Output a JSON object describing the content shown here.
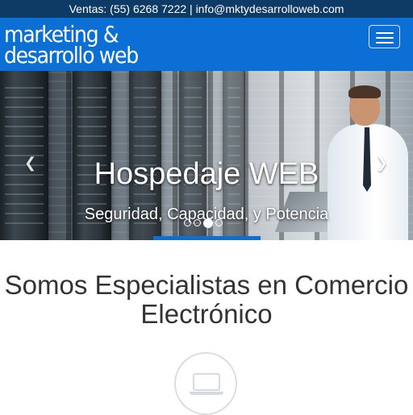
{
  "topbar": {
    "contact": "Ventas: (55) 6268 7222 | info@mktydesarrolloweb.com"
  },
  "navbar": {
    "brand_line1": "marketing &",
    "brand_line2": "desarrollo web",
    "menu_icon": "hamburger-menu-icon"
  },
  "carousel": {
    "title": "Hospedaje WEB",
    "subtitle": "Seguridad, Capacidad, y Potencia",
    "prev_icon": "chevron-left-icon",
    "next_icon": "chevron-right-icon",
    "slide_count": 4,
    "active_slide": 3
  },
  "main": {
    "heading": "Somos Especialistas en Comercio Electrónico",
    "feature_icon": "laptop-icon"
  },
  "colors": {
    "topbar_bg": "#0d3b66",
    "navbar_bg": "#0b6fd6",
    "heading_text": "#333333",
    "icon_circle": "#d9dee2"
  }
}
